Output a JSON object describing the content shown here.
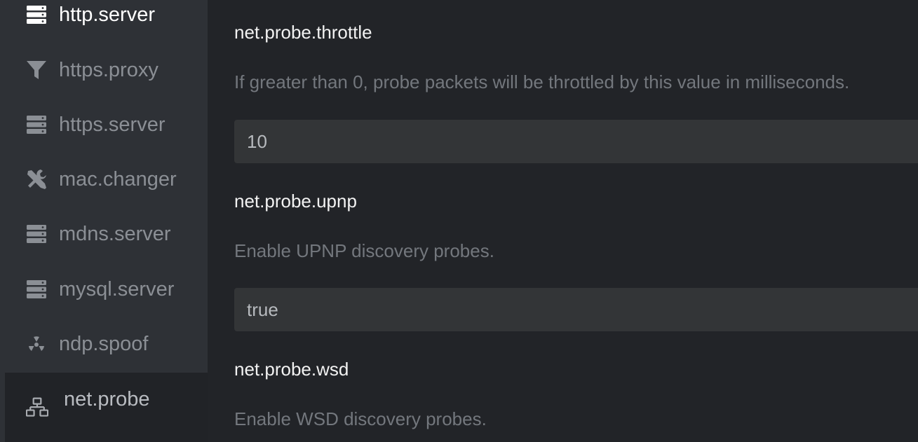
{
  "sidebar": {
    "items": [
      {
        "label": "http.server",
        "icon": "server-icon"
      },
      {
        "label": "https.proxy",
        "icon": "filter-icon"
      },
      {
        "label": "https.server",
        "icon": "server-icon"
      },
      {
        "label": "mac.changer",
        "icon": "tools-icon"
      },
      {
        "label": "mdns.server",
        "icon": "server-icon"
      },
      {
        "label": "mysql.server",
        "icon": "server-icon"
      },
      {
        "label": "ndp.spoof",
        "icon": "radiation-icon"
      },
      {
        "label": "net.probe",
        "icon": "network-icon"
      }
    ],
    "active": "net.probe"
  },
  "params": [
    {
      "name": "net.probe.throttle",
      "description": "If greater than 0, probe packets will be throttled by this value in milliseconds.",
      "value": "10"
    },
    {
      "name": "net.probe.upnp",
      "description": "Enable UPNP discovery probes.",
      "value": "true"
    },
    {
      "name": "net.probe.wsd",
      "description": "Enable WSD discovery probes."
    }
  ],
  "colors": {
    "sidebar_bg": "#2e3136",
    "main_bg": "#222428",
    "input_bg": "#333537",
    "muted_text": "#73777d"
  }
}
